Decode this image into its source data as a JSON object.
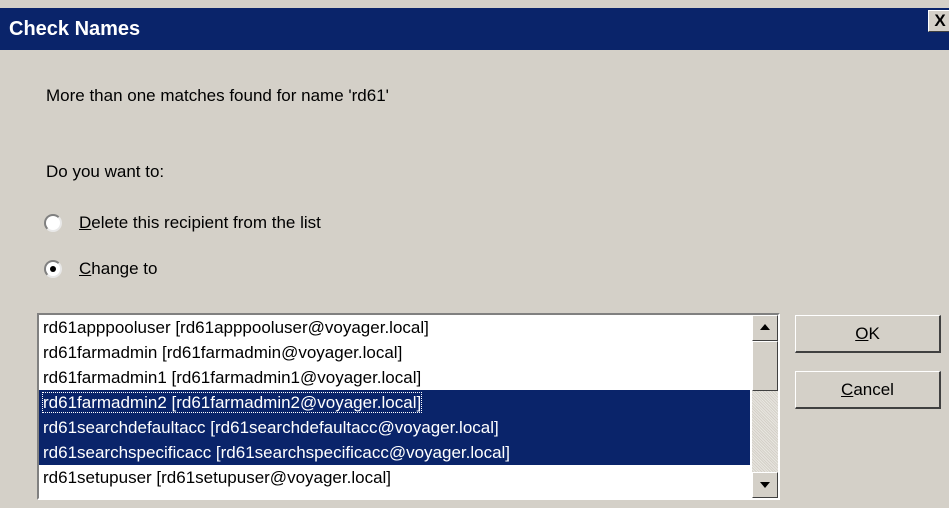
{
  "window": {
    "title": "Check Names",
    "close_label": "X"
  },
  "message": "More than one matches found for name 'rd61'",
  "prompt": "Do you want to:",
  "options": {
    "delete": {
      "mnemonic": "D",
      "rest": "elete this recipient from the list",
      "selected": false
    },
    "change": {
      "mnemonic": "C",
      "rest": "hange to",
      "selected": true
    }
  },
  "list": {
    "items": [
      {
        "text": "rd61apppooluser [rd61apppooluser@voyager.local]",
        "selected": false
      },
      {
        "text": "rd61farmadmin [rd61farmadmin@voyager.local]",
        "selected": false
      },
      {
        "text": "rd61farmadmin1 [rd61farmadmin1@voyager.local]",
        "selected": false
      },
      {
        "text": "rd61farmadmin2 [rd61farmadmin2@voyager.local]",
        "selected": true
      },
      {
        "text": "rd61searchdefaultacc [rd61searchdefaultacc@voyager.local]",
        "selected": true
      },
      {
        "text": "rd61searchspecificacc [rd61searchspecificacc@voyager.local]",
        "selected": true
      },
      {
        "text": "rd61setupuser [rd61setupuser@voyager.local]",
        "selected": false
      }
    ]
  },
  "buttons": {
    "ok": {
      "mnemonic": "O",
      "rest": "K"
    },
    "cancel": {
      "mnemonic": "C",
      "rest": "ancel"
    }
  },
  "colors": {
    "titlebar": "#0a246a",
    "selection": "#0a246a",
    "face": "#d4d0c8"
  }
}
